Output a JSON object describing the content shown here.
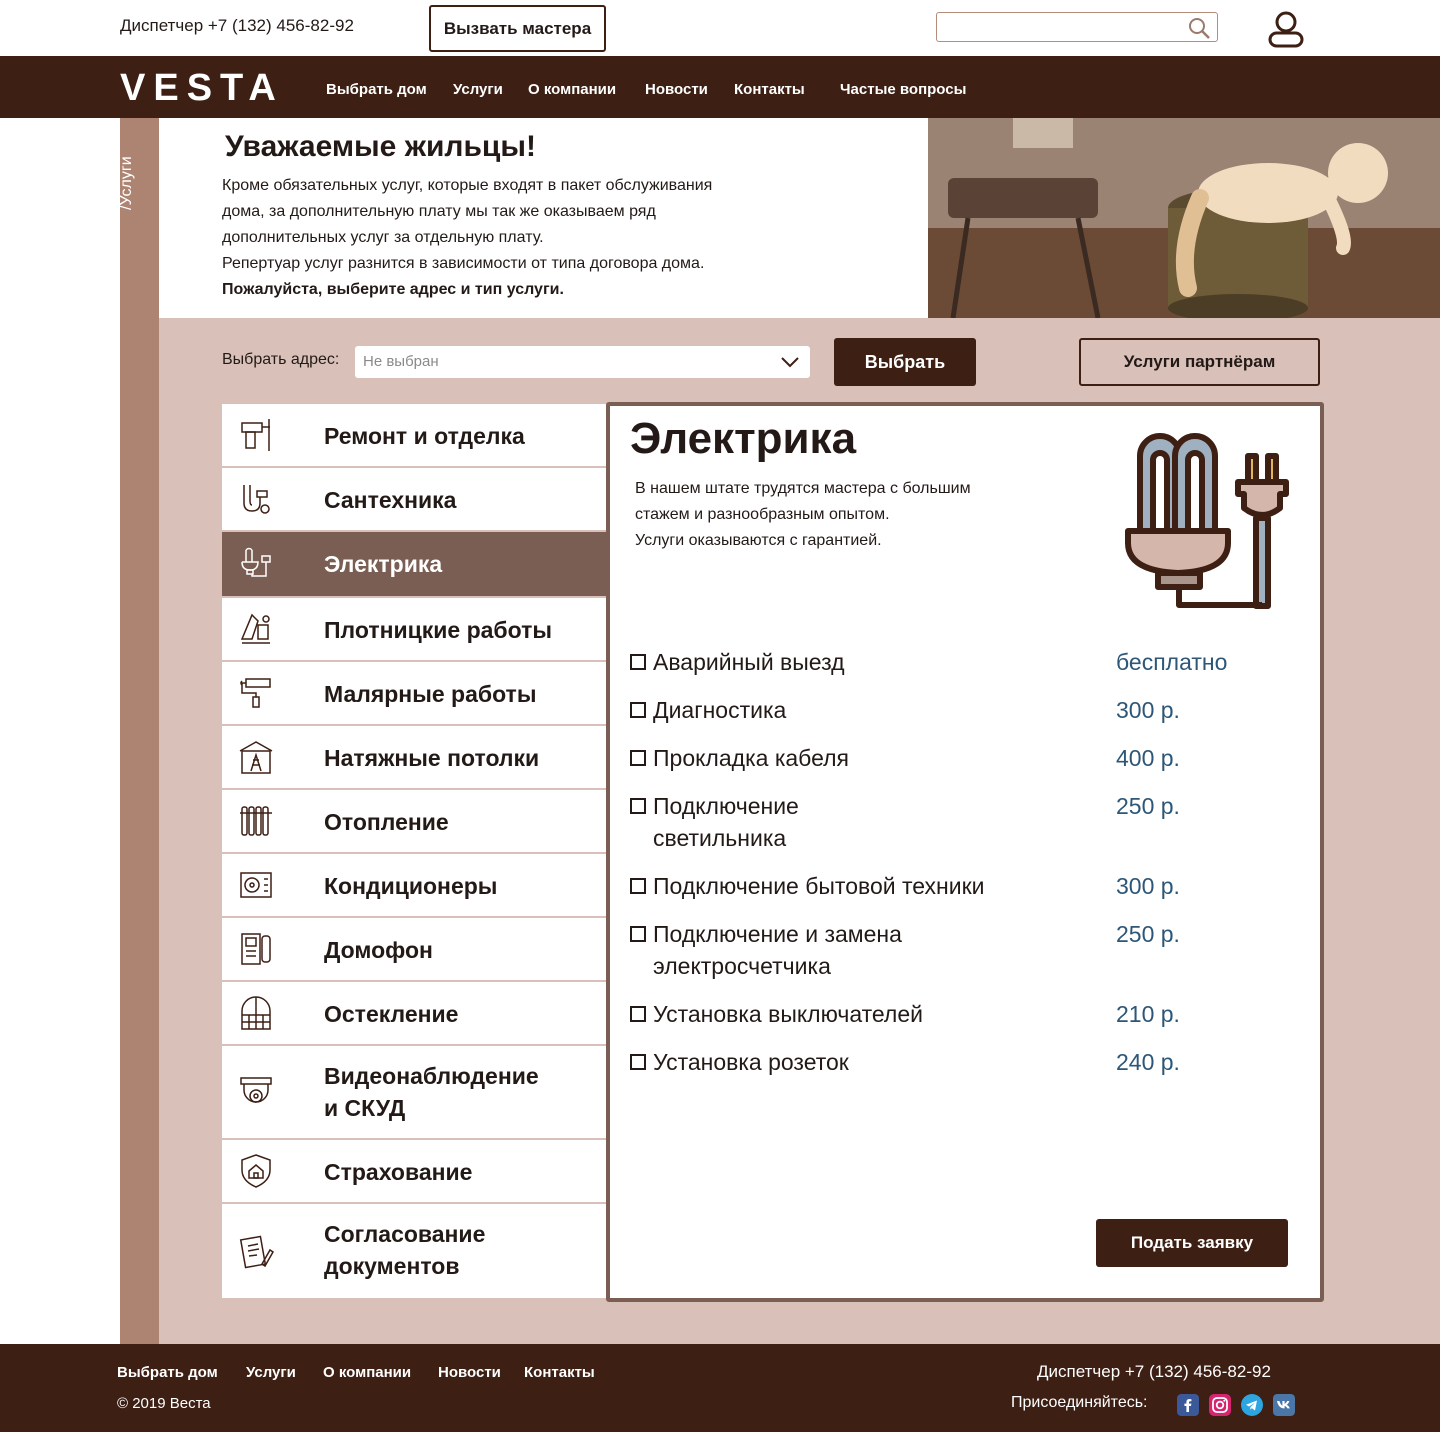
{
  "header": {
    "dispatcher": "Диспетчер +7 (132) 456-82-92",
    "call_master": "Вызвать мастера",
    "search_placeholder": ""
  },
  "nav": {
    "logo": "VESTA",
    "items": [
      "Выбрать  дом",
      "Услуги",
      "О компании",
      "Новости",
      "Контакты",
      "Частые вопросы"
    ]
  },
  "breadcrumb": "/Услуги",
  "intro": {
    "title": "Уважаемые жильцы!",
    "lines": [
      "Кроме обязательных услуг, которые входят в пакет обслуживания",
      "дома, за дополнительную плату мы так же оказываем ряд",
      "дополнительных услуг за отдельную плату.",
      "Репертуар услуг разнится в зависимости от типа договора дома."
    ],
    "bold_line": "Пожалуйста, выберите адрес и тип услуги."
  },
  "address": {
    "label": "Выбрать адрес:",
    "value": "Не выбран",
    "choose": "Выбрать",
    "partners": "Услуги партнёрам"
  },
  "categories": [
    {
      "label": "Ремонт и отделка",
      "icon": "drill-icon",
      "active": false
    },
    {
      "label": "Сантехника",
      "icon": "pipe-icon",
      "active": false
    },
    {
      "label": "Электрика",
      "icon": "bulb-plug-icon",
      "active": true
    },
    {
      "label": "Плотницкие работы",
      "icon": "saw-icon",
      "active": false
    },
    {
      "label": "Малярные работы",
      "icon": "paint-roller-icon",
      "active": false
    },
    {
      "label": "Натяжные потолки",
      "icon": "ladder-room-icon",
      "active": false
    },
    {
      "label": "Отопление",
      "icon": "radiator-icon",
      "active": false
    },
    {
      "label": "Кондиционеры",
      "icon": "air-conditioner-icon",
      "active": false
    },
    {
      "label": "Домофон",
      "icon": "intercom-icon",
      "active": false
    },
    {
      "label": "Остекление",
      "icon": "window-icon",
      "active": false
    },
    {
      "label": "Видеонаблюдение",
      "label2": "и СКУД",
      "icon": "camera-icon",
      "active": false
    },
    {
      "label": "Страхование",
      "icon": "shield-house-icon",
      "active": false
    },
    {
      "label": "Согласование",
      "label2": "документов",
      "icon": "document-icon",
      "active": false
    }
  ],
  "panel": {
    "title": "Электрика",
    "desc": [
      "В нашем штате трудятся мастера с большим",
      "стажем и разнообразным опытом.",
      "Услуги оказываются с гарантией."
    ],
    "services": [
      {
        "name": "Аварийный выезд",
        "price": "бесплатно"
      },
      {
        "name": "Диагностика",
        "price": "300 р."
      },
      {
        "name": "Прокладка кабеля",
        "price": "400 р."
      },
      {
        "name": "Подключение",
        "name2": "светильника",
        "price": "250 р."
      },
      {
        "name": "Подключение бытовой техники",
        "price": "300 р."
      },
      {
        "name": "Подключение и замена",
        "name2": "электросчетчика",
        "price": "250 р."
      },
      {
        "name": "Установка выключателей",
        "price": "210 р."
      },
      {
        "name": "Установка розеток",
        "price": "240 р."
      }
    ],
    "submit": "Подать заявку"
  },
  "footer": {
    "links": [
      "Выбрать дом",
      "Услуги",
      "О компании",
      "Новости",
      "Контакты"
    ],
    "copyright": "© 2019  Веста",
    "phone": "Диспетчер +7 (132) 456-82-92",
    "join": "Присоединяйтесь:",
    "socials": [
      "facebook-icon",
      "instagram-icon",
      "telegram-icon",
      "vk-icon"
    ]
  },
  "colors": {
    "brand_dark": "#3d1f14",
    "side_strip": "#ad8372",
    "pink_bg": "#d9c0b8",
    "active_item": "#7a5e53",
    "price_blue": "#2d5677"
  }
}
